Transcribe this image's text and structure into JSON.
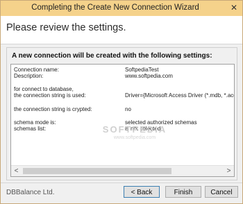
{
  "window": {
    "title": "Completing the Create New Connection Wizard",
    "close_glyph": "✕"
  },
  "header": {
    "text": "Please review the settings."
  },
  "group": {
    "title": "A new connection will be created with the following settings:"
  },
  "settings": [
    {
      "label": "Connection name:",
      "value": "SoftpediaTest"
    },
    {
      "label": "Description:",
      "value": "www.softpedia.com"
    },
    {
      "label": "for connect to database,",
      "value": ""
    },
    {
      "label": "the connection string is used:",
      "value": "Driver={Microsoft Access Driver (*.mdb, *.accdb"
    },
    {
      "label": "the connection string is crypted:",
      "value": "no"
    },
    {
      "label": "schema mode is:",
      "value": "selected authorized schemas"
    },
    {
      "label": "schemas list:",
      "value": "is not selected"
    }
  ],
  "watermark": {
    "text": "SOFTPEDIA",
    "sub": "www.softpedia.com"
  },
  "scrollbar": {
    "left_glyph": "<",
    "right_glyph": ">"
  },
  "footer": {
    "company": "DBBalance Ltd.",
    "back_label": "< Back",
    "finish_label": "Finish",
    "cancel_label": "Cancel"
  },
  "colors": {
    "titlebar": "#f5d28b",
    "accent_border": "#3c7fb1"
  }
}
